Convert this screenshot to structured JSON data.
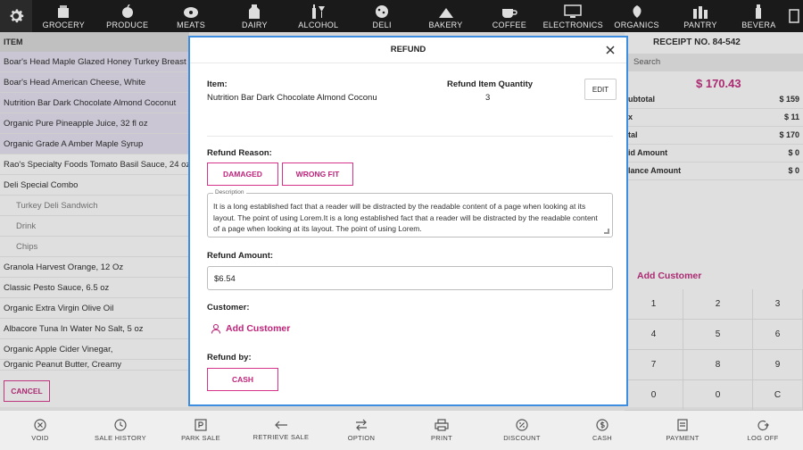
{
  "categories": [
    {
      "label": "GROCERY",
      "icon": "grocery-icon"
    },
    {
      "label": "PRODUCE",
      "icon": "produce-icon"
    },
    {
      "label": "MEATS",
      "icon": "meats-icon"
    },
    {
      "label": "DAIRY",
      "icon": "dairy-icon"
    },
    {
      "label": "ALCOHOL",
      "icon": "alcohol-icon"
    },
    {
      "label": "DELI",
      "icon": "deli-icon"
    },
    {
      "label": "BAKERY",
      "icon": "bakery-icon"
    },
    {
      "label": "COFFEE",
      "icon": "coffee-icon"
    },
    {
      "label": "ELECTRONICS",
      "icon": "electronics-icon"
    },
    {
      "label": "ORGANICS",
      "icon": "organics-icon"
    },
    {
      "label": "PANTRY",
      "icon": "pantry-icon"
    },
    {
      "label": "BEVERA",
      "icon": "beverages-icon"
    }
  ],
  "item_list": {
    "header": "ITEM",
    "rows": [
      {
        "label": "Boar's Head Maple Glazed Honey Turkey Breast",
        "highlight": true
      },
      {
        "label": "Boar's Head American Cheese, White",
        "highlight": true
      },
      {
        "label": "Nutrition Bar Dark Chocolate Almond Coconut",
        "highlight": true
      },
      {
        "label": "Organic Pure Pineapple Juice, 32 fl oz",
        "highlight": true
      },
      {
        "label": "Organic Grade A Amber Maple Syrup",
        "highlight": true
      },
      {
        "label": "Rao's Specialty Foods Tomato Basil Sauce, 24 oz",
        "highlight": false
      },
      {
        "label": "Deli Special Combo",
        "highlight": false
      },
      {
        "label": "Turkey Deli Sandwich",
        "highlight": false,
        "sub": true
      },
      {
        "label": "Drink",
        "highlight": false,
        "sub": true
      },
      {
        "label": "Chips",
        "highlight": false,
        "sub": true
      },
      {
        "label": "Granola Harvest Orange, 12 Oz",
        "highlight": false
      },
      {
        "label": "Classic Pesto Sauce, 6.5 oz",
        "highlight": false
      },
      {
        "label": "Organic Extra Virgin Olive Oil",
        "highlight": false
      },
      {
        "label": "Albacore Tuna In Water No Salt, 5 oz",
        "highlight": false
      },
      {
        "label": "Organic Apple Cider Vinegar,",
        "highlight": false
      },
      {
        "label": "Organic Peanut Butter, Creamy",
        "highlight": false
      }
    ],
    "cancel_label": "CANCEL"
  },
  "receipt": {
    "number": "RECEIPT NO. 84-542",
    "search_placeholder": "Search",
    "total": "$ 170.43",
    "lines": [
      {
        "label": "ubtotal",
        "value": "$ 159"
      },
      {
        "label": "x",
        "value": "$ 11"
      },
      {
        "label": "tal",
        "value": "$ 170"
      },
      {
        "label": "id Amount",
        "value": "$ 0"
      },
      {
        "label": "lance Amount",
        "value": "$ 0"
      }
    ],
    "add_customer": "Add Customer",
    "keypad": [
      "1",
      "2",
      "3",
      "4",
      "5",
      "6",
      "7",
      "8",
      "9",
      "0",
      "0",
      "C"
    ]
  },
  "bottom_actions": [
    {
      "label": "VOID",
      "icon": "void-icon"
    },
    {
      "label": "SALE HISTORY",
      "icon": "history-icon"
    },
    {
      "label": "PARK SALE",
      "icon": "park-icon"
    },
    {
      "label": "RETRIEVE SALE",
      "icon": "retrieve-icon"
    },
    {
      "label": "OPTION",
      "icon": "option-icon"
    },
    {
      "label": "PRINT",
      "icon": "print-icon"
    },
    {
      "label": "DISCOUNT",
      "icon": "discount-icon"
    },
    {
      "label": "CASH",
      "icon": "cash-icon"
    },
    {
      "label": "PAYMENT",
      "icon": "payment-icon"
    },
    {
      "label": "LOG OFF",
      "icon": "logoff-icon"
    }
  ],
  "modal": {
    "title": "REFUND",
    "item_label": "Item:",
    "item_name": "Nutrition Bar Dark Chocolate Almond Coconu",
    "qty_label": "Refund Item Quantity",
    "qty_value": "3",
    "edit_label": "EDIT",
    "reason_label": "Refund Reason:",
    "reason_damaged": "DAMAGED",
    "reason_wrong_fit": "WRONG FIT",
    "description_legend": "Description",
    "description_text": "It is a long established fact that a reader will be distracted by the readable content of a page when looking at its layout. The point of using Lorem.It is a long established fact that a reader will be distracted by the readable content of a page when looking at its layout. The point of using Lorem.",
    "amount_label": "Refund Amount:",
    "amount_value": "$6.54",
    "customer_label": "Customer:",
    "add_customer": "Add Customer",
    "refund_by_label": "Refund by:",
    "cash_label": "CASH"
  },
  "colors": {
    "accent": "#c0237a",
    "modal_border": "#3d8ee0",
    "topbar": "#1a1a1a"
  }
}
